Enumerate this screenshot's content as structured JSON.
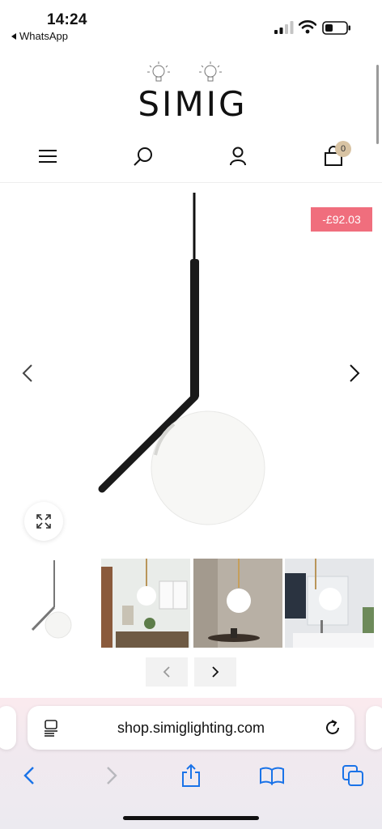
{
  "status_bar": {
    "time": "14:24",
    "back_app": "WhatsApp",
    "icons": [
      "signal-icon",
      "wifi-icon",
      "battery-icon"
    ]
  },
  "header": {
    "logo_text": "SIMIG",
    "nav_icons": [
      "menu-icon",
      "search-icon",
      "account-icon",
      "cart-icon"
    ],
    "cart_count": "0"
  },
  "product": {
    "discount_badge": "-£92.03",
    "gallery_arrows": [
      "chevron-left-icon",
      "chevron-right-icon"
    ],
    "thumbnails": [
      "pendant-lamp-thumbnail",
      "dining-room-thumbnail",
      "bedside-thumbnail",
      "bathroom-thumbnail"
    ]
  },
  "browser": {
    "url": "shop.simiglighting.com",
    "toolbar_icons": [
      "back-icon",
      "forward-icon",
      "share-icon",
      "bookmarks-icon",
      "tabs-icon"
    ]
  },
  "colors": {
    "badge": "#f06e7d",
    "cart_badge": "#d8c3a3",
    "accent_blue": "#1a73e8"
  }
}
